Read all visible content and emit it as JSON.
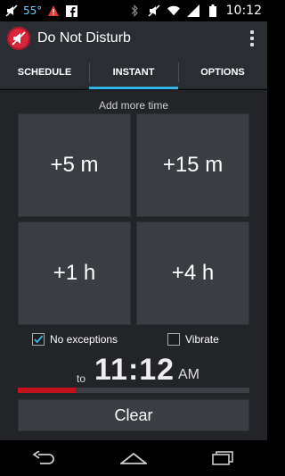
{
  "status_bar": {
    "temperature": "55°",
    "time": "10:12"
  },
  "app": {
    "title": "Do Not Disturb"
  },
  "tabs": [
    {
      "label": "SCHEDULE",
      "active": false
    },
    {
      "label": "INSTANT",
      "active": true
    },
    {
      "label": "OPTIONS",
      "active": false
    }
  ],
  "instant": {
    "add_more_label": "Add more time",
    "buttons": [
      "+5 m",
      "+15 m",
      "+1 h",
      "+4 h"
    ],
    "no_exceptions": {
      "label": "No exceptions",
      "checked": true
    },
    "vibrate": {
      "label": "Vibrate",
      "checked": false
    },
    "to_label": "to",
    "end_time": "11:12",
    "ampm": "AM",
    "progress_fraction": 0.25,
    "clear_label": "Clear"
  },
  "colors": {
    "accent": "#33b5e5",
    "progress": "#c4121c",
    "app_icon": "#d9243a"
  }
}
